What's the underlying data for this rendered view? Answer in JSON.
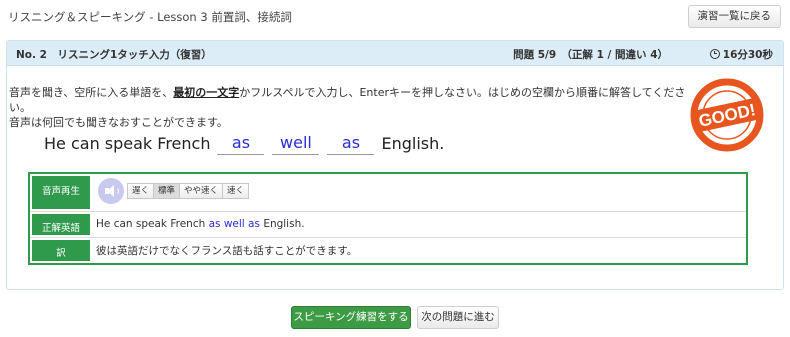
{
  "header": {
    "title": "リスニング＆スピーキング - Lesson 3 前置詞、接続詞",
    "back_label": "演習一覧に戻る"
  },
  "panel": {
    "question": "No. 2　リスニング1タッチ入力（復習）",
    "stats": "問題 5/9　（正解 1 / 間違い 4）",
    "timer": "16分30秒"
  },
  "instructions": {
    "line1_pre": "音声を聞き、空所に入る単語を、",
    "line1_bold": "最初の一文字",
    "line1_post": "かフルスペルで入力し、Enterキーを押しなさい。はじめの空欄から順番に解答してください。",
    "line2": "音声は何回でも聞きなおすことができます。"
  },
  "stamp": {
    "text": "GOOD!",
    "color": "#e8561f"
  },
  "sentence": {
    "start": "He can speak French",
    "blanks": [
      "as",
      "well",
      "as"
    ],
    "end": "English."
  },
  "info": {
    "audio_label": "音声再生",
    "speeds": [
      "遅く",
      "標準",
      "やや速く",
      "速く"
    ],
    "active_speed": "標準",
    "answer_label": "正解英語",
    "answer_pre": "He can speak French",
    "answer_hl": "as well as",
    "answer_post": "English.",
    "translation_label": "訳",
    "translation": "彼は英語だけでなくフランス語も話すことができます。"
  },
  "footer": {
    "speaking_label": "スピーキング練習をする",
    "next_label": "次の問題に進む"
  },
  "colors": {
    "accent_green": "#3e9b45",
    "answer_blue": "#2b2bd8",
    "panel_head": "#dcedf7"
  }
}
